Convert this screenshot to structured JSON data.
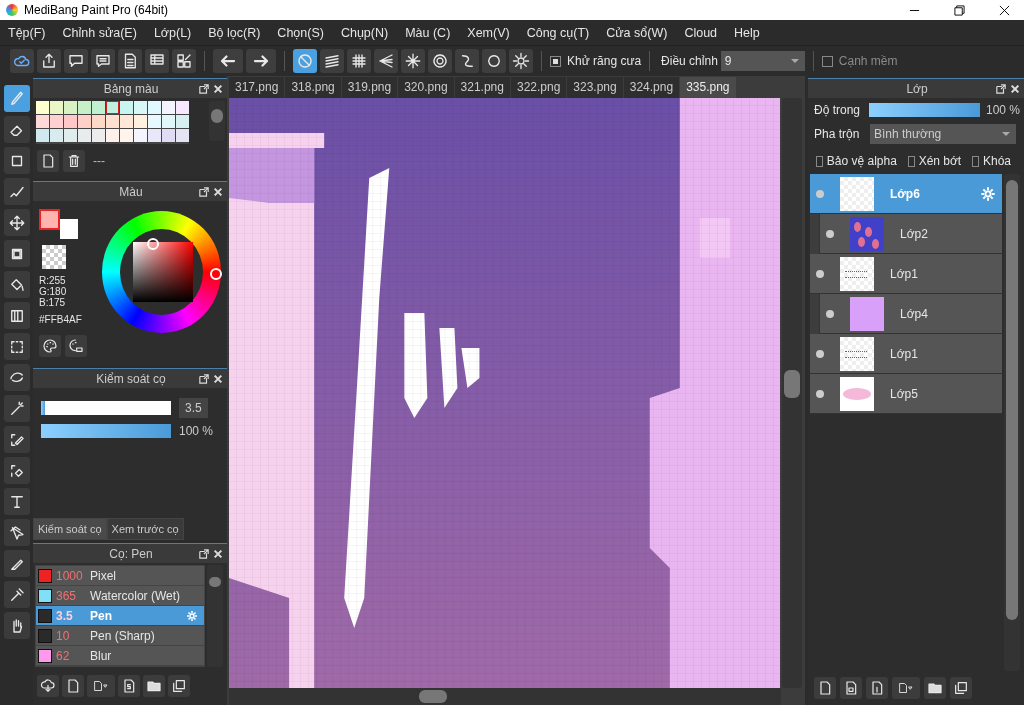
{
  "window": {
    "title": "MediBang Paint Pro (64bit)"
  },
  "menu": [
    "Tệp(F)",
    "Chỉnh sửa(E)",
    "Lớp(L)",
    "Bộ lọc(R)",
    "Chọn(S)",
    "Chụp(N)",
    "Màu (C)",
    "Xem(V)",
    "Công cụ(T)",
    "Cửa sổ(W)",
    "Cloud",
    "Help"
  ],
  "toolbar": {
    "file_tools": [
      {
        "kind": "cloud"
      },
      {
        "kind": "upload"
      },
      {
        "kind": "speech"
      },
      {
        "kind": "comment"
      },
      {
        "kind": "document"
      },
      {
        "kind": "table"
      },
      {
        "kind": "grid-pencil"
      }
    ],
    "history": [
      {
        "kind": "undo"
      },
      {
        "kind": "redo"
      }
    ],
    "rulers": [
      {
        "kind": "no-ruler",
        "selected": true
      },
      {
        "kind": "parallel",
        "selected": false
      },
      {
        "kind": "grid",
        "selected": false
      },
      {
        "kind": "perspective",
        "selected": false
      },
      {
        "kind": "radial",
        "selected": false
      },
      {
        "kind": "concentric",
        "selected": false
      },
      {
        "kind": "curve",
        "selected": false
      },
      {
        "kind": "ellipse",
        "selected": false
      },
      {
        "kind": "gear",
        "selected": false
      }
    ],
    "antialias": {
      "label": "Khử răng cưa",
      "checked": true
    },
    "adjust": {
      "label": "Điều chỉnh",
      "value": "9"
    },
    "soft_edge": {
      "label": "Cạnh mềm",
      "checked": false
    }
  },
  "tools": [
    {
      "kind": "brush",
      "selected": true
    },
    {
      "kind": "eraser",
      "selected": false
    },
    {
      "kind": "dot",
      "selected": false
    },
    {
      "kind": "line-brush",
      "selected": false
    },
    {
      "kind": "move",
      "selected": false
    },
    {
      "kind": "fill-rect",
      "selected": false
    },
    {
      "kind": "bucket",
      "selected": false
    },
    {
      "kind": "gradient",
      "selected": false
    },
    {
      "kind": "select-rect",
      "selected": false
    },
    {
      "kind": "lasso",
      "selected": false
    },
    {
      "kind": "magic-wand",
      "selected": false
    },
    {
      "kind": "select-pen",
      "selected": false
    },
    {
      "kind": "select-eraser",
      "selected": false
    },
    {
      "kind": "text",
      "selected": false
    },
    {
      "kind": "operation",
      "selected": false
    },
    {
      "kind": "knife",
      "selected": false
    },
    {
      "kind": "eyedropper",
      "selected": false
    },
    {
      "kind": "hand",
      "selected": false
    }
  ],
  "palette": {
    "title": "Bảng màu",
    "label": "---",
    "swatches": [
      {
        "color": "#ffffd0",
        "selected": false
      },
      {
        "color": "#eaf5c8",
        "selected": false
      },
      {
        "color": "#d8f2c4",
        "selected": false
      },
      {
        "color": "#c8f0c8",
        "selected": false
      },
      {
        "color": "#bff0d0",
        "selected": false
      },
      {
        "color": "#bff0e0",
        "selected": true
      },
      {
        "color": "#c8f5f0",
        "selected": false
      },
      {
        "color": "#d8f8f8",
        "selected": false
      },
      {
        "color": "#e0f8ff",
        "selected": false
      },
      {
        "color": "#f4f4ff",
        "selected": false
      },
      {
        "color": "#f8e8ff",
        "selected": false
      },
      {
        "color": "#ffd8d8",
        "selected": false
      },
      {
        "color": "#ffd0d0",
        "selected": false
      },
      {
        "color": "#ffc8c8",
        "selected": false
      },
      {
        "color": "#ffd0c8",
        "selected": false
      },
      {
        "color": "#ffd8c8",
        "selected": false
      },
      {
        "color": "#ffe0d0",
        "selected": false
      },
      {
        "color": "#ffe8d8",
        "selected": false
      },
      {
        "color": "#fff0e0",
        "selected": false
      },
      {
        "color": "#e8f8ff",
        "selected": false
      },
      {
        "color": "#e0f8f8",
        "selected": false
      },
      {
        "color": "#d8f0f0",
        "selected": false
      },
      {
        "color": "#d0e8f0",
        "selected": false
      },
      {
        "color": "#d8ecf0",
        "selected": false
      },
      {
        "color": "#e0ecec",
        "selected": false
      },
      {
        "color": "#e8ecec",
        "selected": false
      },
      {
        "color": "#ececec",
        "selected": false
      },
      {
        "color": "#fff0ec",
        "selected": false
      },
      {
        "color": "#fff4ec",
        "selected": false
      },
      {
        "color": "#f4f4ff",
        "selected": false
      },
      {
        "color": "#e8e8fa",
        "selected": false
      },
      {
        "color": "#e0dcf4",
        "selected": false
      },
      {
        "color": "#e4e4f4",
        "selected": false
      }
    ]
  },
  "color": {
    "title": "Màu",
    "swatches": [
      {
        "kind": "background",
        "color": "#ffffff"
      },
      {
        "kind": "foreground",
        "color": "#ffb4af"
      }
    ],
    "r": "R:255",
    "g": "G:180",
    "b": "B:175",
    "hex": "#FFB4AF"
  },
  "brush_control": {
    "title": "Kiểm soát cọ",
    "size": {
      "level": 0.03,
      "value": "3.5"
    },
    "opacity": {
      "level": 1,
      "value": "100 %"
    },
    "tabs": [
      {
        "label": "Kiểm soát cọ",
        "selected": true
      },
      {
        "label": "Xem trước cọ",
        "selected": false
      }
    ]
  },
  "brushes": {
    "title": "Cọ: Pen",
    "items": [
      {
        "color": "#ee2222",
        "size": "1000",
        "name": "Pixel",
        "selected": false
      },
      {
        "color": "#80e0f8",
        "size": "365",
        "name": "Watercolor (Wet)",
        "selected": false
      },
      {
        "color": "#2a2a2a",
        "size": "3.5",
        "name": "Pen",
        "selected": true
      },
      {
        "color": "#2a2a2a",
        "size": "10",
        "name": "Pen (Sharp)",
        "selected": false
      },
      {
        "color": "#ff99ee",
        "size": "62",
        "name": "Blur",
        "selected": false
      }
    ]
  },
  "tabs": [
    {
      "label": "317.png",
      "selected": false
    },
    {
      "label": "318.png",
      "selected": false
    },
    {
      "label": "319.png",
      "selected": false
    },
    {
      "label": "320.png",
      "selected": false
    },
    {
      "label": "321.png",
      "selected": false
    },
    {
      "label": "322.png",
      "selected": false
    },
    {
      "label": "323.png",
      "selected": false
    },
    {
      "label": "324.png",
      "selected": false
    },
    {
      "label": "335.png",
      "selected": true
    }
  ],
  "layers": {
    "title": "Lớp",
    "opacity": {
      "label": "Độ trong",
      "level": 1,
      "value": "100 %"
    },
    "blend": {
      "label": "Pha trộn",
      "value": "Bình thường"
    },
    "options": [
      {
        "label": "Bảo vệ alpha",
        "checked": false
      },
      {
        "label": "Xén bớt",
        "checked": false
      },
      {
        "label": "Khóa",
        "checked": false
      }
    ],
    "items": [
      {
        "name": "Lớp6",
        "kind": "transparent",
        "clipped": false,
        "selected": true
      },
      {
        "name": "Lớp2",
        "kind": "blobs",
        "clipped": true,
        "selected": false
      },
      {
        "name": "Lớp1",
        "kind": "sketch",
        "clipped": false,
        "selected": false
      },
      {
        "name": "Lớp4",
        "kind": "solid",
        "clipped": true,
        "selected": false
      },
      {
        "name": "Lớp1",
        "kind": "sketch",
        "clipped": false,
        "selected": false
      },
      {
        "name": "Lớp5",
        "kind": "ellipse",
        "clipped": false,
        "selected": false
      }
    ]
  }
}
